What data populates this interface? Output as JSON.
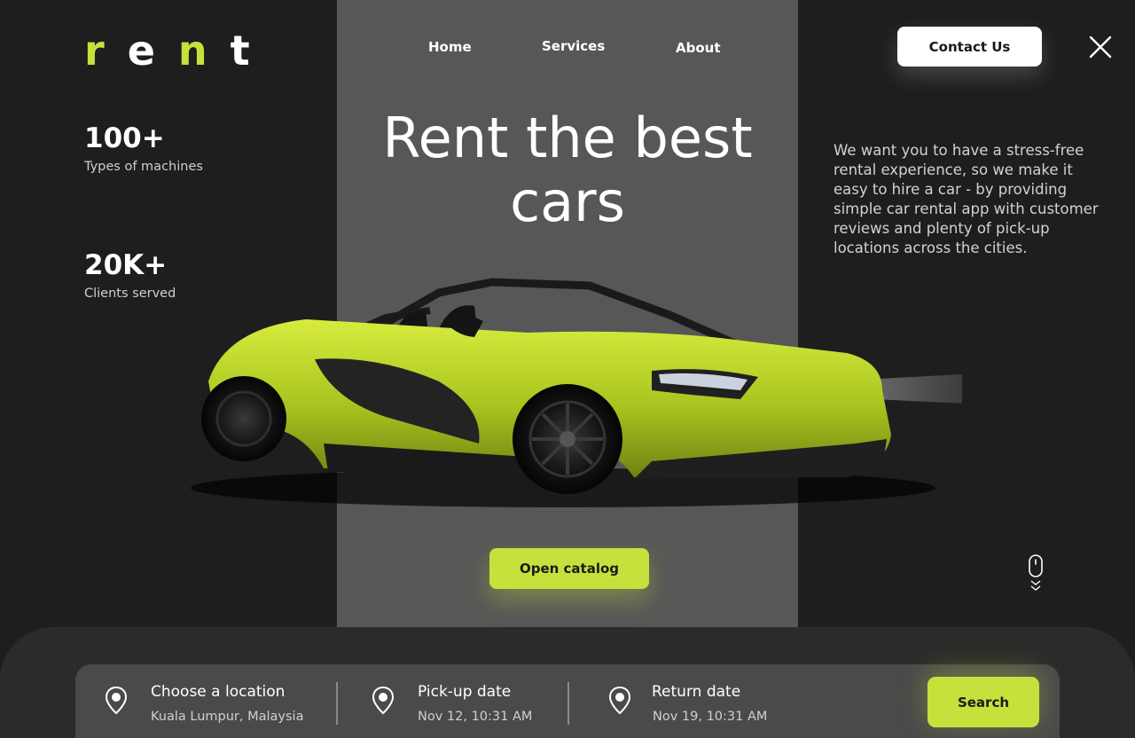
{
  "brand": {
    "letters": [
      "r",
      "e",
      "n",
      "t"
    ]
  },
  "nav": {
    "home": "Home",
    "services": "Services",
    "about": "About"
  },
  "header": {
    "contact_label": "Contact Us",
    "close_icon": "close-icon"
  },
  "stats": [
    {
      "value": "100+",
      "label": "Types of machines"
    },
    {
      "value": "20K+",
      "label": "Clients served"
    }
  ],
  "hero": {
    "title_line1": "Rent the best",
    "title_line2": "cars",
    "description": "We want you to have a stress-free rental experience, so we make it easy to hire a car - by providing simple car rental app with customer reviews and plenty of pick-up locations across the cities.",
    "catalog_label": "Open catalog"
  },
  "search": {
    "location": {
      "title": "Choose a location",
      "value": "Kuala Lumpur, Malaysia",
      "icon": "location-pin-icon"
    },
    "pickup": {
      "title": "Pick-up date",
      "value": "Nov 12, 10:31 AM",
      "icon": "location-pin-icon"
    },
    "return": {
      "title": "Return date",
      "value": "Nov 19, 10:31 AM",
      "icon": "location-pin-icon"
    },
    "button_label": "Search"
  },
  "colors": {
    "accent": "#c8e03c",
    "background": "#1e1e1e",
    "panel": "#575757",
    "search_bar": "#4a4a4a"
  }
}
